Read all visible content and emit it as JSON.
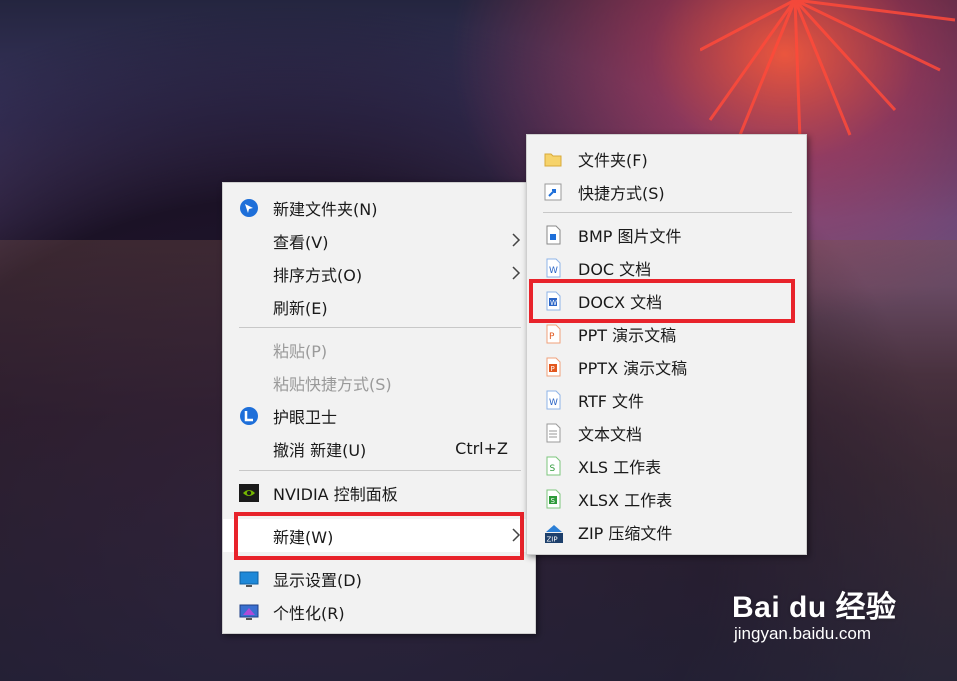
{
  "context_menu": {
    "items": [
      {
        "label": "新建文件夹(N)",
        "icon": "new-folder-app-icon"
      },
      {
        "label": "查看(V)",
        "submenu": true
      },
      {
        "label": "排序方式(O)",
        "submenu": true
      },
      {
        "label": "刷新(E)"
      },
      {
        "label": "粘贴(P)",
        "disabled": true
      },
      {
        "label": "粘贴快捷方式(S)",
        "disabled": true
      },
      {
        "label": "护眼卫士",
        "icon": "eye-guard-icon"
      },
      {
        "label": "撤消 新建(U)",
        "shortcut": "Ctrl+Z"
      },
      {
        "label": "NVIDIA 控制面板",
        "icon": "nvidia-icon"
      },
      {
        "label": "新建(W)",
        "submenu": true,
        "highlighted": true
      },
      {
        "label": "显示设置(D)",
        "icon": "display-settings-icon"
      },
      {
        "label": "个性化(R)",
        "icon": "personalize-icon"
      }
    ]
  },
  "new_submenu": {
    "items": [
      {
        "label": "文件夹(F)",
        "icon": "folder-icon"
      },
      {
        "label": "快捷方式(S)",
        "icon": "shortcut-icon"
      },
      {
        "label": "BMP 图片文件",
        "icon": "bmp-file-icon"
      },
      {
        "label": "DOC 文档",
        "icon": "doc-file-icon"
      },
      {
        "label": "DOCX 文档",
        "icon": "docx-file-icon",
        "highlighted": true
      },
      {
        "label": "PPT 演示文稿",
        "icon": "ppt-file-icon"
      },
      {
        "label": "PPTX 演示文稿",
        "icon": "pptx-file-icon"
      },
      {
        "label": "RTF 文件",
        "icon": "rtf-file-icon"
      },
      {
        "label": "文本文档",
        "icon": "text-file-icon"
      },
      {
        "label": "XLS 工作表",
        "icon": "xls-file-icon"
      },
      {
        "label": "XLSX 工作表",
        "icon": "xlsx-file-icon"
      },
      {
        "label": "ZIP 压缩文件",
        "icon": "zip-file-icon"
      }
    ]
  },
  "watermark": {
    "brand": "Bai du 经验",
    "url": "jingyan.baidu.com"
  },
  "colors": {
    "highlight_box": "#e8232b",
    "menu_bg": "#f2f2f2"
  }
}
